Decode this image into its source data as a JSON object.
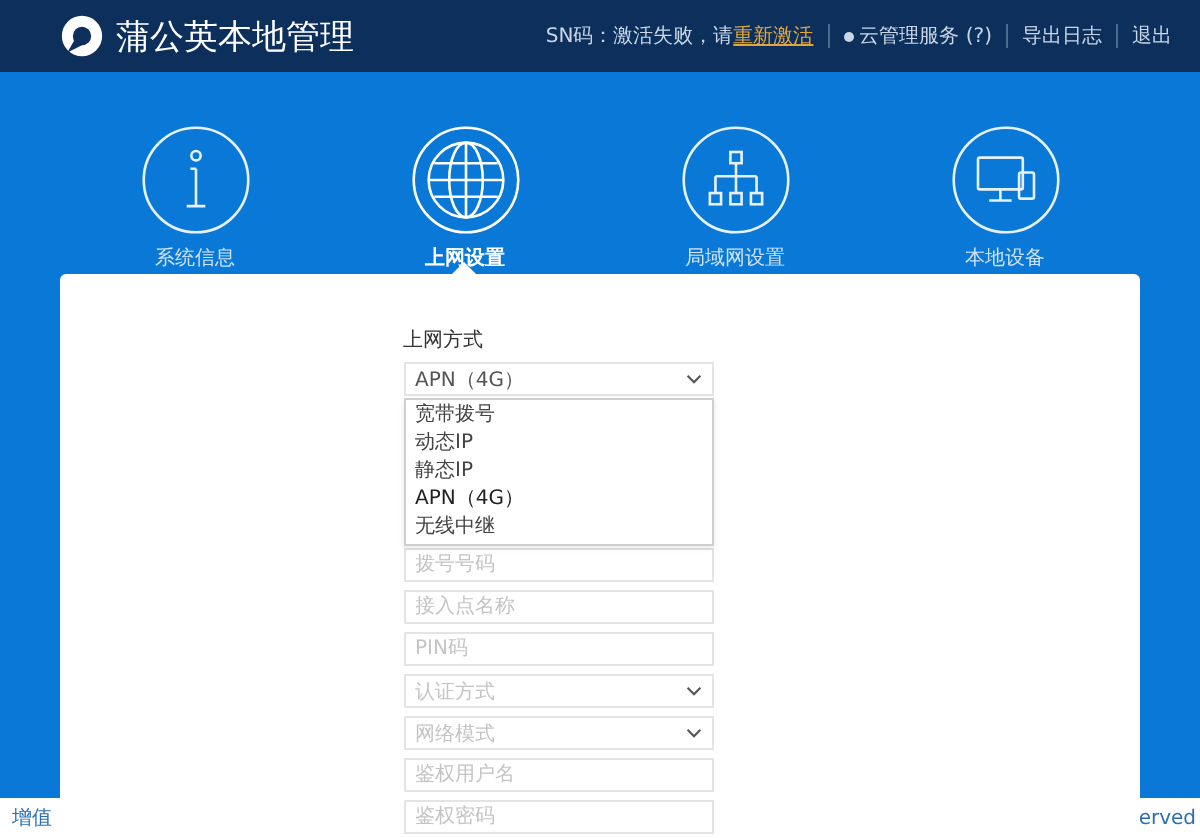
{
  "header": {
    "title": "蒲公英本地管理",
    "sn_text": "SN码：激活失败，请",
    "activate_link": "重新激活",
    "cloud_service": "云管理服务 (?)",
    "export_log": "导出日志",
    "logout": "退出"
  },
  "nav": [
    {
      "label": "系统信息",
      "selected": false
    },
    {
      "label": "上网设置",
      "selected": true
    },
    {
      "label": "局域网设置",
      "selected": false
    },
    {
      "label": "本地设备",
      "selected": false
    }
  ],
  "form": {
    "label": "上网方式",
    "select_value": "APN（4G）",
    "dropdown": [
      {
        "label": "宽带拨号",
        "selected": false
      },
      {
        "label": "动态IP",
        "selected": false
      },
      {
        "label": "静态IP",
        "selected": false
      },
      {
        "label": "APN（4G）",
        "selected": true
      },
      {
        "label": "无线中继",
        "selected": false
      }
    ],
    "fields": [
      {
        "kind": "input",
        "placeholder": "拨号号码"
      },
      {
        "kind": "input",
        "placeholder": "接入点名称"
      },
      {
        "kind": "input",
        "placeholder": "PIN码"
      },
      {
        "kind": "select",
        "placeholder": "认证方式"
      },
      {
        "kind": "select",
        "placeholder": "网络模式"
      },
      {
        "kind": "input",
        "placeholder": "鉴权用户名"
      },
      {
        "kind": "input",
        "placeholder": "鉴权密码"
      }
    ]
  },
  "footer": {
    "left": "增值",
    "right": "erved"
  }
}
